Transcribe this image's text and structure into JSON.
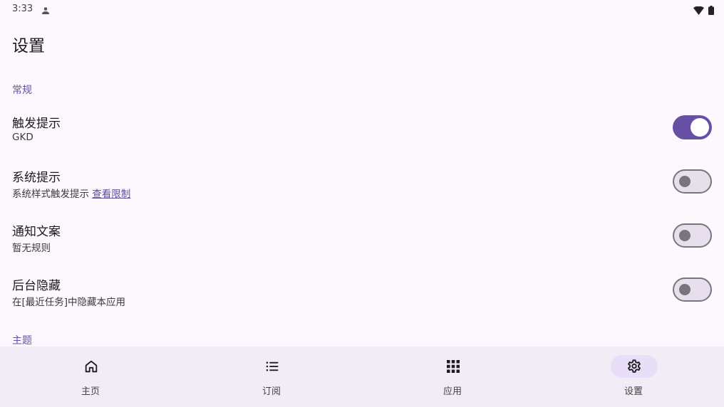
{
  "status": {
    "time": "3:33"
  },
  "page": {
    "title": "设置"
  },
  "sections": {
    "general": "常规",
    "theme": "主题"
  },
  "settings": [
    {
      "title": "触发提示",
      "subtitle": "GKD",
      "enabled": true
    },
    {
      "title": "系统提示",
      "subtitle": "系统样式触发提示",
      "link": "查看限制",
      "enabled": false
    },
    {
      "title": "通知文案",
      "subtitle": "暂无规则",
      "enabled": false
    },
    {
      "title": "后台隐藏",
      "subtitle": "在[最近任务]中隐藏本应用",
      "enabled": false
    }
  ],
  "nav": [
    {
      "label": "主页",
      "icon": "home-icon"
    },
    {
      "label": "订阅",
      "icon": "list-icon"
    },
    {
      "label": "应用",
      "icon": "apps-grid-icon"
    },
    {
      "label": "设置",
      "icon": "gear-icon",
      "active": true
    }
  ],
  "colors": {
    "accent": "#6750a4",
    "background": "#fdf7fe",
    "navbar": "#f2ecf6",
    "active_pill": "#e8def8"
  }
}
